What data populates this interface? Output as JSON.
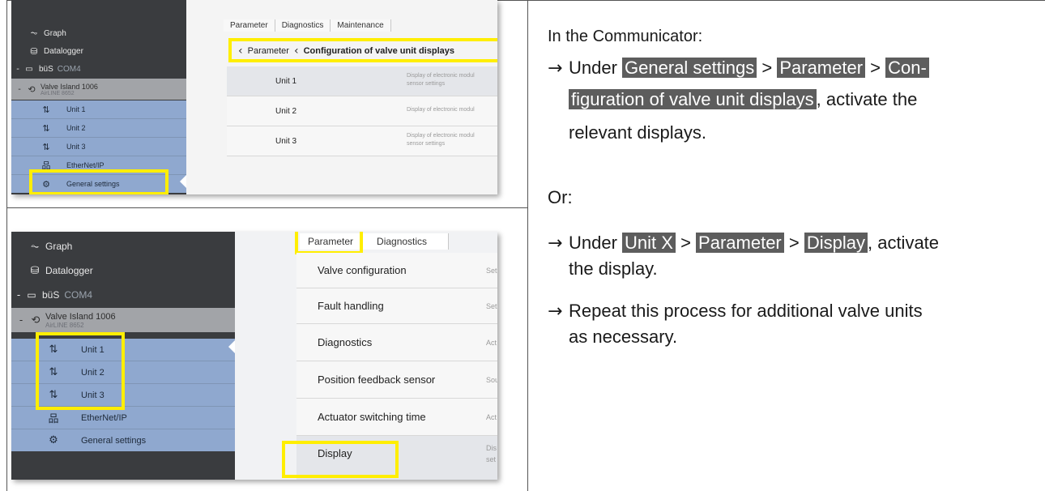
{
  "screenshot1": {
    "sidebar": {
      "graph": "Graph",
      "datalogger": "Datalogger",
      "bus": "büS",
      "bus_port": "COM4",
      "device_name": "Valve Island 1006",
      "device_model": "AirLINE 8652",
      "units": [
        "Unit 1",
        "Unit 2",
        "Unit 3"
      ],
      "ethernet": "EtherNet/IP",
      "general_settings": "General settings"
    },
    "tabs": [
      "Parameter",
      "Diagnostics",
      "Maintenance"
    ],
    "breadcrumb": {
      "back": "Parameter",
      "current": "Configuration of valve unit displays"
    },
    "rows": [
      {
        "name": "Unit 1",
        "desc": "Display of electronic modul",
        "desc2": "sensor settings"
      },
      {
        "name": "Unit 2",
        "desc": "Display of electronic modul",
        "desc2": ""
      },
      {
        "name": "Unit 3",
        "desc": "Display of electronic modul",
        "desc2": "sensor settings"
      }
    ]
  },
  "screenshot2": {
    "sidebar": {
      "graph": "Graph",
      "datalogger": "Datalogger",
      "bus": "büS",
      "bus_port": "COM4",
      "device_name": "Valve Island 1006",
      "device_model": "AirLINE 8652",
      "units": [
        "Unit 1",
        "Unit 2",
        "Unit 3"
      ],
      "ethernet": "EtherNet/IP",
      "general_settings": "General settings"
    },
    "tabs": [
      "Parameter",
      "Diagnostics"
    ],
    "rows": [
      {
        "name": "Valve configuration",
        "desc": "Set"
      },
      {
        "name": "Fault handling",
        "desc": "Set"
      },
      {
        "name": "Diagnostics",
        "desc": "Act"
      },
      {
        "name": "Position feedback sensor",
        "desc": "Sou"
      },
      {
        "name": "Actuator switching time",
        "desc": "Act"
      },
      {
        "name": "Display",
        "desc": "Dis",
        "desc2": "set"
      }
    ]
  },
  "instructions": {
    "heading": "In the Communicator:",
    "step1": {
      "arrow": "→",
      "prefix": "Under ",
      "tag1": "General settings",
      "sep1": " > ",
      "tag2": "Parameter",
      "sep2": " > ",
      "tag3a": "Con-",
      "tag3b": "figuration of valve unit displays",
      "suffix": ", activate the",
      "line3": "relevant displays."
    },
    "or": "Or:",
    "step2": {
      "arrow": "→",
      "prefix": "Under ",
      "tag1": "Unit X",
      "sep1": " > ",
      "tag2": "Parameter",
      "sep2": " > ",
      "tag3": "Display",
      "suffix": ", activate",
      "line2": "the display."
    },
    "step3": {
      "arrow": "→",
      "line1": "Repeat this process for additional valve units",
      "line2": "as necessary."
    }
  },
  "colors": {
    "highlight": "#ffee00",
    "tag_bg": "#5d5d5d",
    "sidebar_bg": "#3a3c3f",
    "unit_row_bg": "#8fa8cf"
  }
}
